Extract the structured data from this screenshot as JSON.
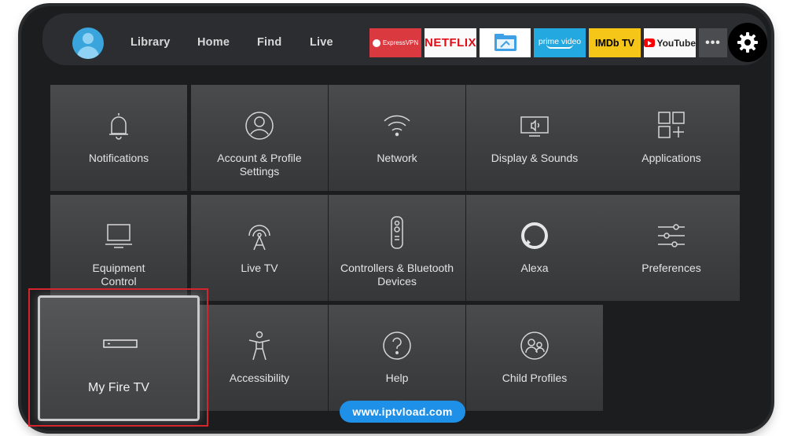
{
  "nav": {
    "library": "Library",
    "home": "Home",
    "find": "Find",
    "live": "Live"
  },
  "apps": {
    "expressvpn": "ExpressVPN",
    "netflix": "NETFLIX",
    "prime_line1": "prime video",
    "imdb": "IMDb TV",
    "youtube": "YouTube",
    "more": "•••"
  },
  "tiles": {
    "notifications": "Notifications",
    "account_line1": "Account & Profile",
    "account_line2": "Settings",
    "network": "Network",
    "display": "Display & Sounds",
    "applications": "Applications",
    "equipment_line1": "Equipment",
    "equipment_line2": "Control",
    "live_tv": "Live TV",
    "controllers_line1": "Controllers & Bluetooth",
    "controllers_line2": "Devices",
    "alexa": "Alexa",
    "preferences": "Preferences",
    "my_fire_tv": "My Fire TV",
    "accessibility": "Accessibility",
    "help": "Help",
    "child_profiles": "Child Profiles"
  },
  "watermark": "www.iptvload.com",
  "colors": {
    "focus_outline": "#d4242e",
    "watermark_bg": "#1e90e8",
    "tile_bg": "#434446"
  },
  "icons": {
    "gear": "gear-icon",
    "bell": "bell-icon",
    "profile": "profile-icon",
    "wifi": "wifi-icon",
    "display": "display-icon",
    "apps": "apps-grid-icon",
    "monitor": "monitor-icon",
    "antenna": "antenna-icon",
    "remote": "remote-icon",
    "alexa": "alexa-ring-icon",
    "sliders": "sliders-icon",
    "firetv": "fire-tv-device-icon",
    "accessibility": "accessibility-icon",
    "help": "help-icon",
    "child": "child-profiles-icon"
  }
}
